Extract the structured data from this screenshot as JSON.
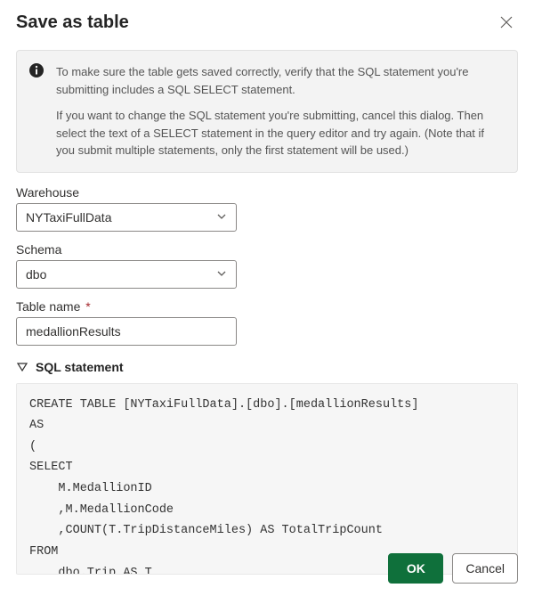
{
  "dialog": {
    "title": "Save as table",
    "info_paragraphs": [
      "To make sure the table gets saved correctly, verify that the SQL statement you're submitting includes a SQL SELECT statement.",
      "If you want to change the SQL statement you're submitting, cancel this dialog. Then select the text of a SELECT statement in the query editor and try again. (Note that if you submit multiple statements, only the first statement will be used.)"
    ]
  },
  "fields": {
    "warehouse": {
      "label": "Warehouse",
      "value": "NYTaxiFullData"
    },
    "schema": {
      "label": "Schema",
      "value": "dbo"
    },
    "table_name": {
      "label": "Table name",
      "required_mark": "*",
      "value": "medallionResults"
    }
  },
  "sql_section": {
    "header": "SQL statement",
    "code": "CREATE TABLE [NYTaxiFullData].[dbo].[medallionResults]\nAS\n(\nSELECT\n    M.MedallionID\n    ,M.MedallionCode\n    ,COUNT(T.TripDistanceMiles) AS TotalTripCount\nFROM\n    dbo.Trip AS T\nJOIN\n"
  },
  "footer": {
    "ok_label": "OK",
    "cancel_label": "Cancel"
  }
}
